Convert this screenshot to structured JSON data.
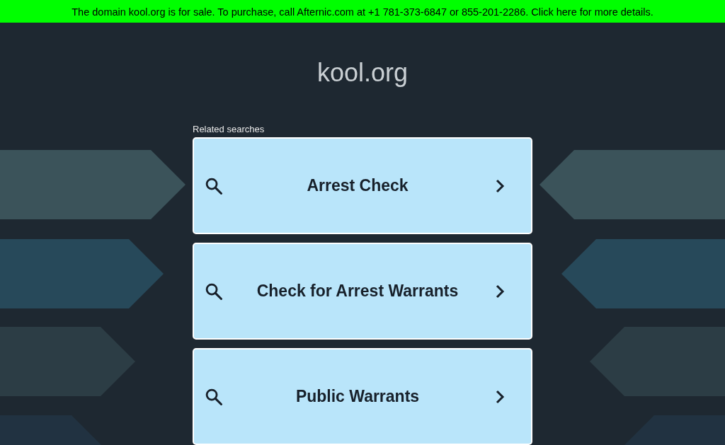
{
  "banner": {
    "text": "The domain kool.org is for sale. To purchase, call Afternic.com at +1 781-373-6847 or 855-201-2286. Click here for more details."
  },
  "title": "kool.org",
  "related_searches": {
    "heading": "Related searches",
    "items": [
      {
        "label": "Arrest Check"
      },
      {
        "label": "Check for Arrest Warrants"
      },
      {
        "label": "Public Warrants"
      }
    ]
  }
}
